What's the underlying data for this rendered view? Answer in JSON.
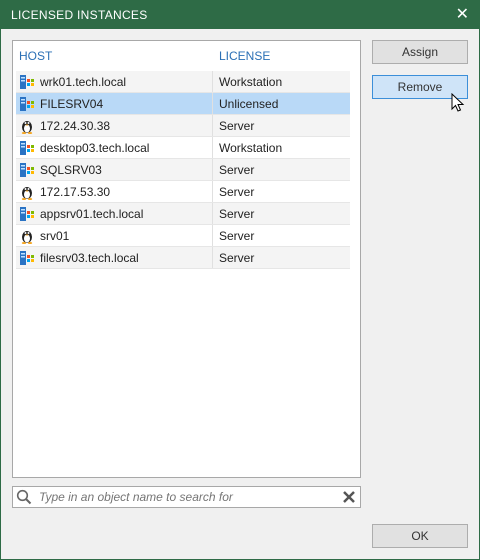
{
  "window": {
    "title": "LICENSED INSTANCES"
  },
  "table": {
    "headers": {
      "host": "HOST",
      "license": "LICENSE"
    },
    "rows": [
      {
        "host": "wrk01.tech.local",
        "license": "Workstation",
        "icon": "windows-server-icon"
      },
      {
        "host": "FILESRV04",
        "license": "Unlicensed",
        "icon": "windows-server-icon",
        "selected": true
      },
      {
        "host": "172.24.30.38",
        "license": "Server",
        "icon": "linux-tux-icon"
      },
      {
        "host": "desktop03.tech.local",
        "license": "Workstation",
        "icon": "windows-server-icon"
      },
      {
        "host": "SQLSRV03",
        "license": "Server",
        "icon": "windows-server-icon"
      },
      {
        "host": "172.17.53.30",
        "license": "Server",
        "icon": "linux-tux-icon"
      },
      {
        "host": "appsrv01.tech.local",
        "license": "Server",
        "icon": "windows-server-icon"
      },
      {
        "host": "srv01",
        "license": "Server",
        "icon": "linux-tux-icon"
      },
      {
        "host": "filesrv03.tech.local",
        "license": "Server",
        "icon": "windows-server-icon"
      }
    ]
  },
  "search": {
    "placeholder": "Type in an object name to search for"
  },
  "buttons": {
    "assign": "Assign",
    "remove": "Remove",
    "ok": "OK"
  }
}
